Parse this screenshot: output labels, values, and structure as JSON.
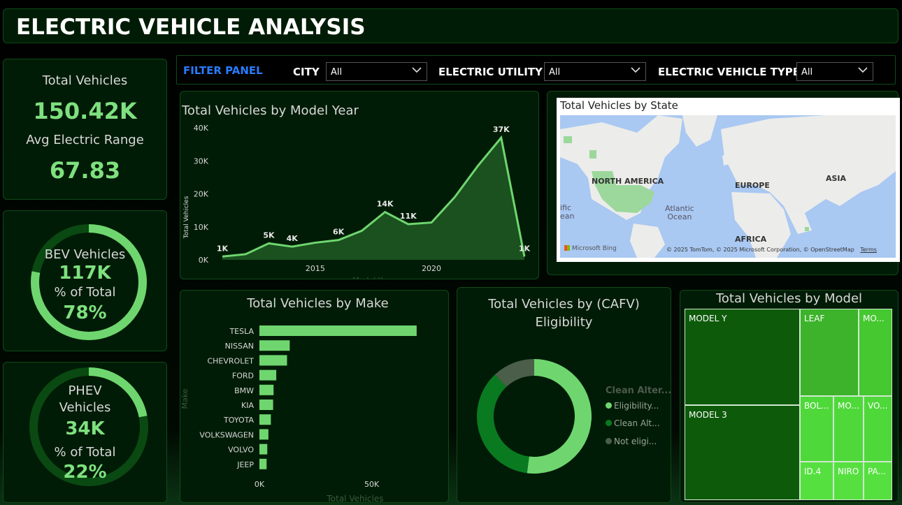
{
  "header": {
    "title": "ELECTRIC VEHICLE ANALYSIS"
  },
  "kpi": {
    "total_label": "Total Vehicles",
    "total_value": "150.42K",
    "range_label": "Avg Electric Range",
    "range_value": "67.83"
  },
  "bev": {
    "label": "BEV Vehicles",
    "value": "117K",
    "pct_label": "% of Total",
    "pct_value": "78%",
    "fraction": 0.78
  },
  "phev": {
    "label_1": "PHEV",
    "label_2": "Vehicles",
    "value": "34K",
    "pct_label": "% of Total",
    "pct_value": "22%",
    "fraction": 0.22
  },
  "filters": {
    "title": "FILTER PANEL",
    "city_label": "CITY",
    "city_value": "All",
    "utility_label": "ELECTRIC UTILITY",
    "utility_value": "All",
    "type_label": "ELECTRIC VEHICLE TYPE",
    "type_value": "All"
  },
  "model_year_chart": {
    "title": "Total Vehicles by Model Year",
    "ylabel": "Total Vehicles",
    "xlabel": "Model Year",
    "y_ticks": [
      "40K",
      "30K",
      "20K",
      "10K",
      "0K"
    ],
    "x_ticks": [
      "2015",
      "2020"
    ]
  },
  "map": {
    "title": "Total Vehicles by State",
    "labels": {
      "na": "NORTH AMERICA",
      "eu": "EUROPE",
      "asia": "ASIA",
      "africa": "AFRICA",
      "ocean_1": "Atlantic",
      "ocean_2": "Ocean",
      "pacific_1": "ific",
      "pacific_2": "ean"
    },
    "bing": "Microsoft Bing",
    "copyright": "© 2025 TomTom, © 2025 Microsoft Corporation, © OpenStreetMap",
    "terms": "Terms"
  },
  "make_chart": {
    "title": "Total Vehicles by Make",
    "ylabel": "Make",
    "xlabel": "Total Vehicles",
    "x_ticks": [
      "0K",
      "50K"
    ]
  },
  "cafv_chart": {
    "title_1": "Total Vehicles by (CAFV)",
    "title_2": "Eligibility",
    "legend_title": "Clean Alter...",
    "legend": [
      "Eligibility...",
      "Clean Alt...",
      "Not eligi..."
    ]
  },
  "treemap": {
    "title": "Total Vehicles by Model",
    "cells": [
      "MODEL Y",
      "MODEL 3",
      "LEAF",
      "MO...",
      "BOL...",
      "MO...",
      "VO...",
      "ID.4",
      "NIRO",
      "PA..."
    ]
  },
  "colors": {
    "accent": "#6fd66f",
    "dark_green": "#0a6b1c",
    "grey_green": "#4a5e4a",
    "ring_track": "#0a4a12"
  },
  "chart_data": [
    {
      "type": "area",
      "title": "Total Vehicles by Model Year",
      "xlabel": "Model Year",
      "ylabel": "Total Vehicles",
      "x": [
        2011,
        2012,
        2013,
        2014,
        2015,
        2016,
        2017,
        2018,
        2019,
        2020,
        2021,
        2022,
        2023,
        2024
      ],
      "values": [
        1000,
        1700,
        5000,
        4000,
        5200,
        6000,
        8800,
        14500,
        10800,
        11300,
        19000,
        28500,
        37000,
        1000
      ],
      "data_labels": {
        "2011": "1K",
        "2013": "5K",
        "2014": "4K",
        "2016": "6K",
        "2018": "14K",
        "2019": "11K",
        "2023": "37K",
        "2024": "1K"
      },
      "ylim": [
        0,
        40000
      ]
    },
    {
      "type": "bar",
      "title": "Total Vehicles by Make",
      "xlabel": "Total Vehicles",
      "ylabel": "Make",
      "categories": [
        "TESLA",
        "NISSAN",
        "CHEVROLET",
        "FORD",
        "BMW",
        "KIA",
        "TOYOTA",
        "VOLKSWAGEN",
        "VOLVO",
        "JEEP"
      ],
      "values": [
        70000,
        13500,
        12300,
        7500,
        6300,
        6100,
        5100,
        4000,
        3500,
        3200
      ],
      "xlim": [
        0,
        80000
      ]
    },
    {
      "type": "pie",
      "title": "Total Vehicles by (CAFV) Eligibility",
      "categories": [
        "Eligibility...",
        "Clean Alt...",
        "Not eligi..."
      ],
      "values": [
        52,
        36,
        12
      ]
    }
  ]
}
